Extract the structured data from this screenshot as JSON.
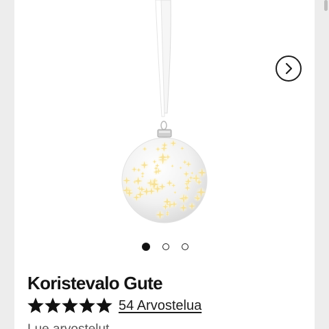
{
  "product": {
    "title": "Koristevalo Gute",
    "rating": 5,
    "rating_max": 5,
    "reviews_label": "54 Arvostelua",
    "image_name": "white-star-bauble-ornament"
  },
  "gallery": {
    "image_count": 3,
    "active_index": 0,
    "next_icon": "chevron-right-icon"
  },
  "partial_line": "Lue arvostelut..."
}
